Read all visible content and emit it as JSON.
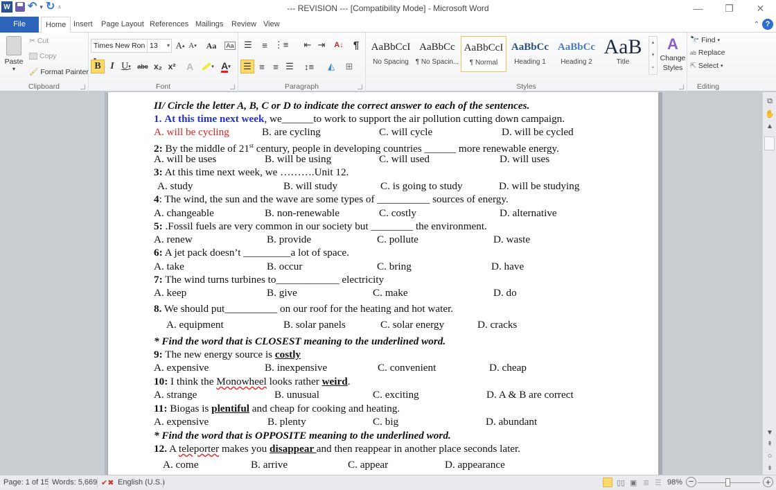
{
  "window": {
    "title": "--- REVISION --- [Compatibility Mode] - Microsoft Word",
    "controls": [
      "minimize",
      "restore",
      "close"
    ]
  },
  "quick_access": {
    "app_icon": "W",
    "items": [
      "save-icon",
      "undo-icon",
      "redo-icon",
      "customize-icon"
    ]
  },
  "tabs": [
    {
      "label": "File"
    },
    {
      "label": "Home",
      "active": true
    },
    {
      "label": "Insert"
    },
    {
      "label": "Page Layout"
    },
    {
      "label": "References"
    },
    {
      "label": "Mailings"
    },
    {
      "label": "Review"
    },
    {
      "label": "View"
    }
  ],
  "ribbon": {
    "clipboard": {
      "label": "Clipboard",
      "paste": "Paste",
      "cut": "Cut",
      "copy": "Copy",
      "format_painter": "Format Painter"
    },
    "font": {
      "label": "Font",
      "font_name": "Times New Ron",
      "font_size": "13",
      "grow": "A",
      "shrink": "A",
      "change_case": "Aa",
      "bold": "B",
      "italic": "I",
      "underline": "U",
      "strikethrough": "abc",
      "subscript": "x₂",
      "superscript": "x²",
      "highlight_color": "#f5e63a",
      "font_color": "#e02020"
    },
    "paragraph": {
      "label": "Paragraph"
    },
    "styles": {
      "label": "Styles",
      "items": [
        {
          "sample": "AaBbCcI",
          "name": "No Spacing"
        },
        {
          "sample": "AaBbCc",
          "name": "¶ No Spacin..."
        },
        {
          "sample": "AaBbCcI",
          "name": "¶ Normal",
          "selected": true
        },
        {
          "sample": "AaBbCc",
          "name": "Heading 1"
        },
        {
          "sample": "AaBbCc",
          "name": "Heading 2"
        },
        {
          "sample": "AaB",
          "name": "Title"
        }
      ],
      "change_styles": "Change Styles"
    },
    "editing": {
      "label": "Editing",
      "find": "Find",
      "replace": "Replace",
      "select": "Select"
    }
  },
  "document": {
    "instruction1": "II/ Circle the letter A, B, C or D to indicate the correct answer to each of the sentences.",
    "questions": [
      {
        "num": "1.",
        "pre_blue": "At this time next week",
        "text": ", we______to work to support the air pollution cutting down campaign.",
        "options": [
          "A. will be cycling",
          "B. are cycling",
          "C. will cycle",
          "D. will be cycled"
        ]
      },
      {
        "num": "2:",
        "text_a": " By the middle of 21",
        "sup": "st",
        "text_b": " century, people in developing countries ______ more renewable energy.",
        "options": [
          "A. will be uses",
          "B. will be using",
          "C. will used",
          "D. will uses"
        ]
      },
      {
        "num": "3:",
        "text": " At this time next week, we ……….Unit 12.",
        "options": [
          "A. study",
          "B. will study",
          "C. is going to study",
          "D. will be studying"
        ]
      },
      {
        "num": "4",
        "text": ": The wind, the sun and the wave are some types of __________ sources of energy.",
        "options": [
          "A. changeable",
          "B. non-renewable",
          "C. costly",
          "D. alternative"
        ]
      },
      {
        "num": "5:",
        "text": " .Fossil fuels are very common in our society but ________ the environment.",
        "options": [
          "A. renew",
          "B. provide",
          "C. pollute",
          "D. waste"
        ]
      },
      {
        "num": "6:",
        "text": " A jet pack doesn’t _________a lot of space.",
        "options": [
          "A. take",
          "B. occur",
          "C. bring",
          "D. have"
        ]
      },
      {
        "num": "7:",
        "text": " The wind turns turbines to____________ electricity",
        "options": [
          "A. keep",
          "B. give",
          "C. make",
          "D. do"
        ]
      },
      {
        "num": "8.",
        "text": " We should put__________ on our roof for the heating and hot water.",
        "options": [
          "A. equipment",
          "B. solar panels",
          "C. solar energy",
          "D. cracks"
        ]
      },
      {
        "num": "9:",
        "text": " The new energy source is ",
        "underlined": "costly",
        "options": [
          "A. expensive",
          "B. inexpensive",
          "C. convenient",
          "D. cheap"
        ]
      },
      {
        "num": "10:",
        "text_a": " I think the ",
        "spell": "Monowheel",
        "text_b": " looks rather ",
        "underlined": "weird",
        "after": ".",
        "options": [
          "A. strange",
          "B. unusual",
          "C. exciting",
          "D. A & B are correct"
        ]
      },
      {
        "num": "11:",
        "text_a": " Biogas is ",
        "underlined": "plentiful",
        "text_b": " and cheap for cooking and heating.",
        "options": [
          "A. expensive",
          "B. plenty",
          "C. big",
          "D. abundant"
        ]
      },
      {
        "num": "12.",
        "text_a": " A ",
        "spell": "teleporter",
        "text_b": " makes you ",
        "underlined": "disappear ",
        "after": "and then reappear in another place seconds later.",
        "options": [
          "A. come",
          "B. arrive",
          "C. appear",
          "D. appearance"
        ]
      }
    ],
    "instruction_closest": "* Find the word that is CLOSEST meaning to the underlined word.",
    "instruction_opposite": "* Find the word that is OPPOSITE meaning to the underlined word."
  },
  "status_bar": {
    "page": "Page: 1 of 15",
    "words": "Words: 5,669",
    "language": "English (U.S.)",
    "zoom": "98%",
    "zoom_level_percent": 98
  }
}
